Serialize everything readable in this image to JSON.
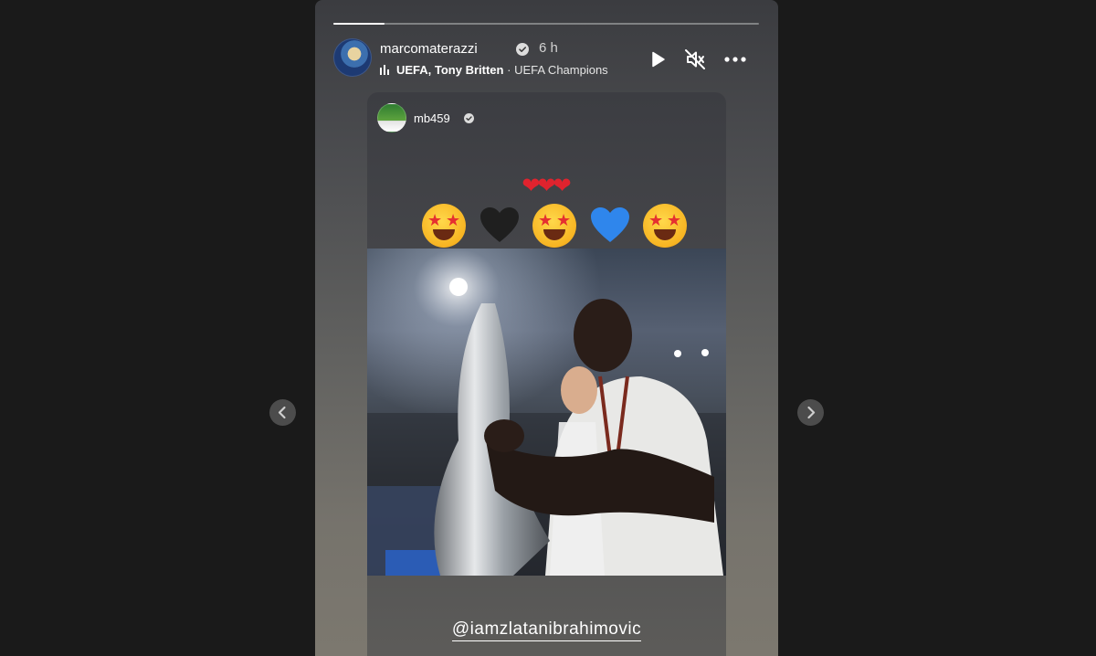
{
  "story": {
    "progress": 0.12,
    "header": {
      "username": "marcomaterazzi",
      "time": "6 h",
      "music_artist": "UEFA, Tony Britten",
      "music_separator": "·",
      "music_song": "UEFA Champions"
    },
    "controls": {
      "play_icon": "play-icon",
      "mute_icon": "speaker-muted-icon",
      "more_icon": "more-options-icon"
    },
    "shared_post": {
      "username": "mb459",
      "hearts": "❤❤❤",
      "emoji_sequence": [
        "star-struck",
        "black-heart",
        "star-struck",
        "blue-heart",
        "star-struck"
      ],
      "mention": "@iamzlatanibrahimovic"
    }
  },
  "navigation": {
    "prev_icon": "chevron-left-icon",
    "next_icon": "chevron-right-icon"
  },
  "colors": {
    "heart_red": "#e0232e",
    "heart_black": "#1f1f1f",
    "heart_blue": "#2f86ec",
    "background": "#1a1a1a"
  }
}
